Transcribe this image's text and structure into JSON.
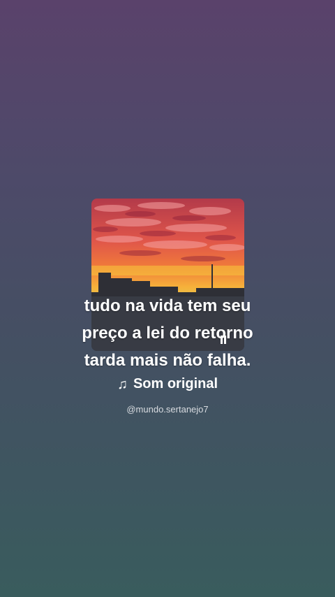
{
  "post": {
    "caption_lines": [
      "tudo na vida tem seu",
      "preço a lei do retorno",
      "tarda mais não falha."
    ],
    "sound_label": "Som original",
    "handle": "@mundo.sertanejo7"
  },
  "icons": {
    "music_note": "music-note-icon",
    "pause": "pause-icon"
  },
  "colors": {
    "caption": "#ffffff",
    "handle": "#d8dbe0"
  }
}
